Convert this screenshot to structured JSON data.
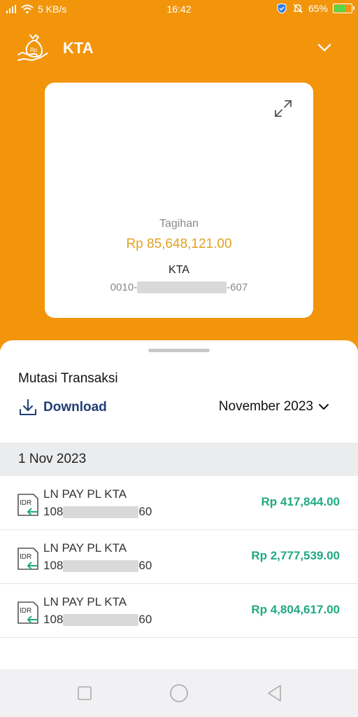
{
  "status_bar": {
    "net_speed": "5 KB/s",
    "time": "16:42",
    "battery_percent": "65%",
    "battery_level": 0.65
  },
  "header": {
    "title": "KTA"
  },
  "card": {
    "label": "Tagihan",
    "amount": "Rp 85,648,121.00",
    "product": "KTA",
    "account_prefix": "0010-",
    "account_suffix": "-607"
  },
  "mutations": {
    "title": "Mutasi Transaksi",
    "download_label": "Download",
    "month": "November 2023",
    "date_group": "1 Nov 2023",
    "transactions": [
      {
        "currency": "IDR",
        "title": "LN PAY PL KTA",
        "acct_prefix": "108",
        "acct_suffix": "60",
        "amount": "Rp 417,844.00"
      },
      {
        "currency": "IDR",
        "title": "LN PAY PL KTA",
        "acct_prefix": "108",
        "acct_suffix": "60",
        "amount": "Rp 2,777,539.00"
      },
      {
        "currency": "IDR",
        "title": "LN PAY PL KTA",
        "acct_prefix": "108",
        "acct_suffix": "60",
        "amount": "Rp 4,804,617.00"
      }
    ]
  },
  "colors": {
    "brand_orange": "#f2950b",
    "amount_gold": "#e0a222",
    "credit_green": "#20a980",
    "link_blue": "#1f3e74"
  },
  "icons": [
    "signal-icon",
    "wifi-icon",
    "shield-icon",
    "mute-icon",
    "battery-icon",
    "money-bag-icon",
    "chevron-down-icon",
    "expand-icon",
    "download-icon",
    "idr-incoming-icon",
    "square-icon",
    "circle-icon",
    "back-triangle-icon"
  ]
}
